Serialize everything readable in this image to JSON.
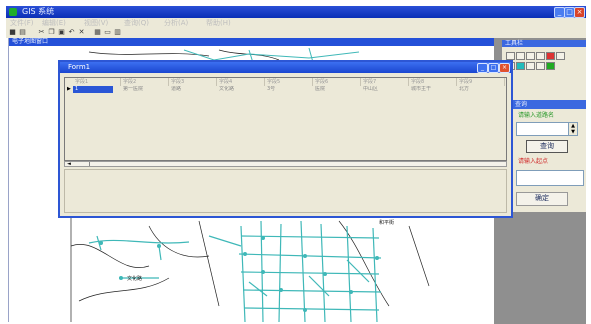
{
  "app": {
    "title": "GIS 系统",
    "menus": [
      "文件(F)",
      "编辑(E)",
      "视图(V)",
      "查询(Q)",
      "分析(A)",
      "帮助(H)"
    ],
    "window_controls": [
      "_",
      "□",
      "×"
    ],
    "toolbar_icons": [
      "save-icon",
      "print-icon",
      "cut-icon",
      "copy-icon",
      "paste-icon",
      "undo-icon",
      "delete-icon",
      "table-icon",
      "window-icon",
      "grid-icon"
    ]
  },
  "map_window": {
    "title": "电子地图窗口",
    "labels": [
      "文化路",
      "和平街"
    ]
  },
  "dialog": {
    "title": "Form1",
    "buttons": [
      "_",
      "□",
      "×"
    ],
    "columns": [
      "字段1",
      "字段2",
      "字段3",
      "字段4",
      "字段5",
      "字段6",
      "字段7",
      "字段8",
      "字段9"
    ],
    "row": {
      "indicator": "▶",
      "cells": [
        "1",
        "第一医院",
        "道路",
        "文化路",
        "3号",
        "医院",
        "中山区",
        "城市主干",
        "北方"
      ]
    },
    "scroll_left": "◄"
  },
  "tool_panel": {
    "title": "工具栏"
  },
  "query_panel": {
    "title": "查询",
    "green_label": "请输入道路名",
    "query_button": "查询",
    "red_label": "请输入起点",
    "bottom_button": "确定"
  },
  "colors": {
    "titlebar": "#0a2fb6",
    "road": "#3fb8b8",
    "dialog_border": "#2d56d4"
  }
}
